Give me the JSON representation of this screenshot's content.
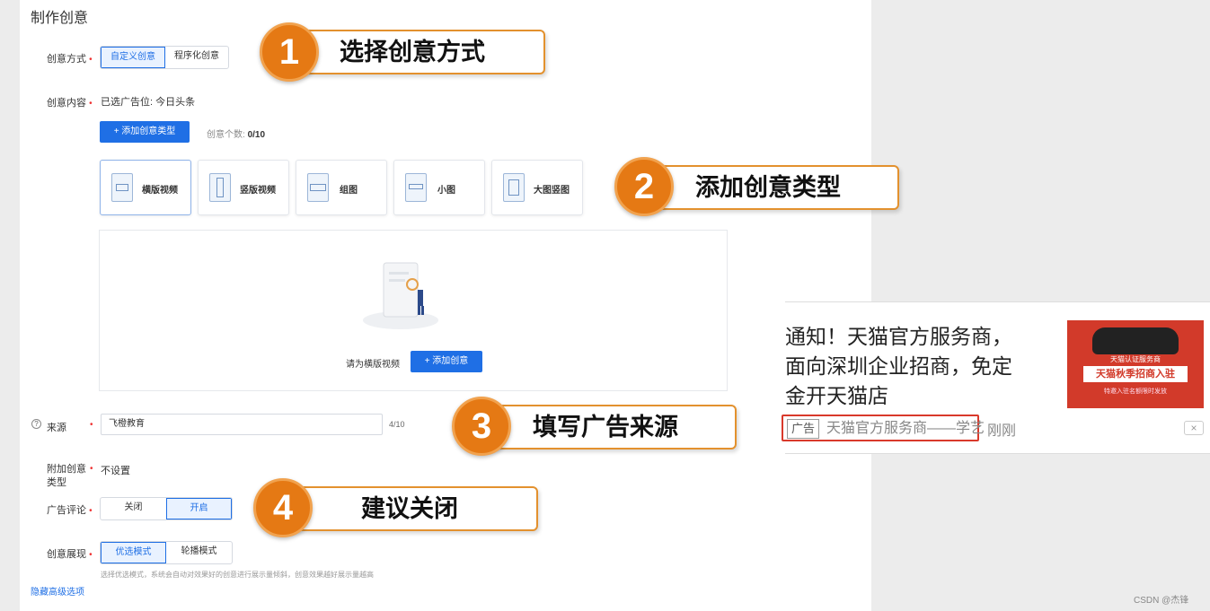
{
  "page_title": "制作创意",
  "mode": {
    "label": "创意方式",
    "options": [
      "自定义创意",
      "程序化创意"
    ]
  },
  "content": {
    "label": "创意内容",
    "value": "已选广告位: 今日头条",
    "add_type_btn": "+ 添加创意类型",
    "count_label": "创意个数:",
    "count_value": "0/10"
  },
  "types": [
    "横版视频",
    "竖版视频",
    "组图",
    "小图",
    "大图竖图"
  ],
  "empty": {
    "hint": "请为横版视频",
    "add_btn": "+ 添加创意"
  },
  "source": {
    "label": "来源",
    "value": "飞橙教育",
    "counter": "4/10"
  },
  "extra": {
    "label_line1": "附加创意",
    "label_line2": "类型",
    "value": "不设置"
  },
  "comments": {
    "label": "广告评论",
    "options": [
      "关闭",
      "开启"
    ]
  },
  "display": {
    "label": "创意展现",
    "options": [
      "优选模式",
      "轮播模式"
    ],
    "desc": "选择优选模式，系统会自动对效果好的创意进行展示量倾斜，创意效果越好展示量越高"
  },
  "hide_advanced": "隐藏高级选项",
  "callouts": [
    {
      "num": "1",
      "text": "选择创意方式"
    },
    {
      "num": "2",
      "text": "添加创意类型"
    },
    {
      "num": "3",
      "text": "填写广告来源"
    },
    {
      "num": "4",
      "text": "建议关闭"
    }
  ],
  "ad_preview": {
    "lines": [
      "通知！天猫官方服务商，",
      "面向深圳企业招商，免定",
      "金开天猫店"
    ],
    "tag": "广告",
    "source": "天猫官方服务商——学艺",
    "time": "刚刚",
    "close": "×",
    "banner_top": "天猫认证服务商",
    "banner_main": "天猫秋季招商入驻",
    "banner_bottom": "特邀入驻名额限时发放"
  },
  "watermark": "CSDN @杰锋",
  "colors": {
    "primary": "#1f6fe5",
    "accent": "#e57914",
    "ad_red": "#d23a2a"
  }
}
